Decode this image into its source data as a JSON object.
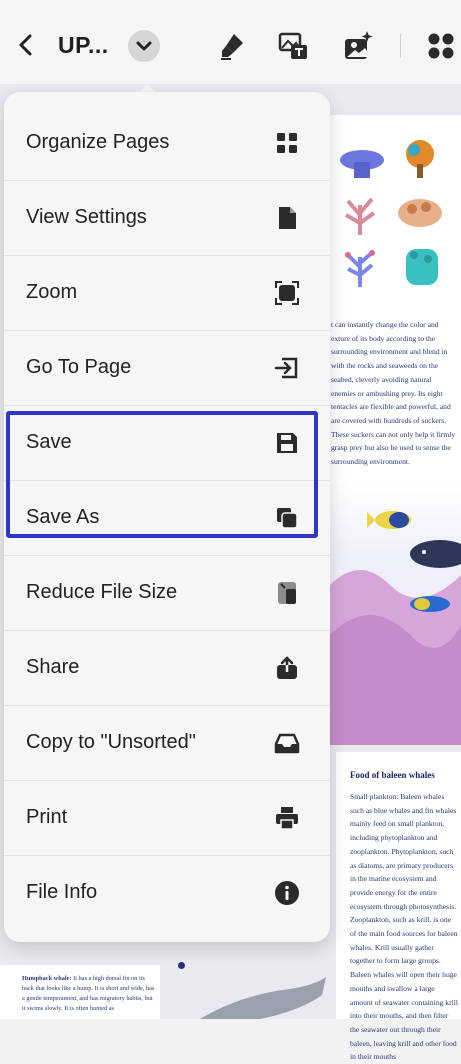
{
  "topbar": {
    "title": "UP...",
    "icons": [
      "back-arrow-icon",
      "chevron-down-icon",
      "highlighter-icon",
      "image-text-icon",
      "image-edit-icon",
      "apps-grid-icon"
    ]
  },
  "menu": {
    "items": [
      {
        "label": "Organize Pages",
        "icon": "grid-icon"
      },
      {
        "label": "View Settings",
        "icon": "document-icon"
      },
      {
        "label": "Zoom",
        "icon": "zoom-frame-icon"
      },
      {
        "label": "Go To Page",
        "icon": "go-to-page-icon"
      },
      {
        "label": "Save",
        "icon": "floppy-disk-icon"
      },
      {
        "label": "Save As",
        "icon": "copy-icon"
      },
      {
        "label": "Reduce File Size",
        "icon": "compress-file-icon"
      },
      {
        "label": "Share",
        "icon": "share-icon"
      },
      {
        "label": "Copy to \"Unsorted\"",
        "icon": "inbox-tray-icon"
      },
      {
        "label": "Print",
        "icon": "printer-icon"
      },
      {
        "label": "File Info",
        "icon": "info-icon"
      }
    ],
    "highlight_color": "#2e35c9"
  },
  "document": {
    "paragraph_1": "t can instantly change the color and exture of its body according to the surrounding environment and blend in with the rocks and seaweeds on the seabed, cleverly avoiding natural enemies or ambushing prey. Its eight tentacles are flexible and powerful, and are covered with hundreds of suckers. These suckers can not only help it firmly grasp prey but also be used to sense the surrounding environment.",
    "heading": "Food of baleen whales",
    "paragraph_2": "Small plankton: Baleen whales such as blue whales and fin whales mainly feed on small plankton, including phytoplankton and zooplankton. Phytoplankton, such as diatoms, are primary producers in the marine ecosystem and provide energy for the entire ecosystem through photosynthesis. Zooplankton, such as krill, is one of the main food sources for baleen whales. Krill usually gather together to form large groups. Baleen whales will open their huge mouths and swallow a large amount of seawater containing krill into their mouths, and then filter the seawater out through their baleen, leaving krill and other food in their mouths",
    "paragraph_3_label": "Humpback whale:",
    "paragraph_3": "It has a high dorsal fin on its back that looks like a hump. It is short and wide, has a gentle temperament, and has migratory habits, but it swims slowly. It is often hunted as"
  }
}
